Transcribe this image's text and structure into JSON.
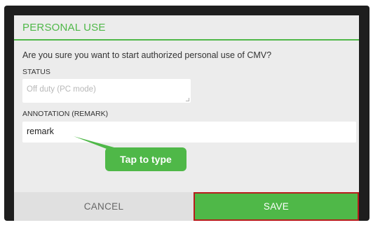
{
  "dialog": {
    "title": "PERSONAL USE",
    "question": "Are you sure you want to start authorized personal use of CMV?",
    "status_label": "STATUS",
    "status_value": "Off duty (PC mode)",
    "annotation_label": "ANNOTATION (REMARK)",
    "annotation_value": "remark",
    "tooltip": "Tap to type",
    "cancel_label": "CANCEL",
    "save_label": "SAVE"
  },
  "colors": {
    "accent": "#4fb848",
    "highlight_border": "#b71c1c"
  }
}
